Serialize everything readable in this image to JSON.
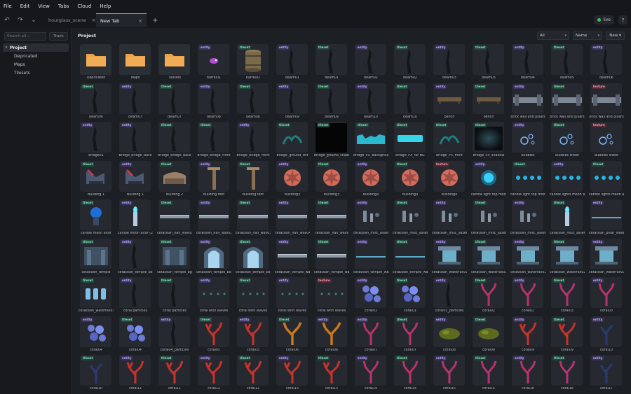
{
  "menu": [
    "File",
    "Edit",
    "View",
    "Tabs",
    "Cloud",
    "Help"
  ],
  "toolbar": {
    "undo_icon": "undo-icon",
    "redo_icon": "redo-icon",
    "dropdown_icon": "chevron-down-icon"
  },
  "tabs": [
    {
      "label": "hourglass_scene",
      "active": false
    },
    {
      "label": "New Tab",
      "active": true
    }
  ],
  "tab_close": "×",
  "tab_add": "+",
  "status": {
    "label": "live",
    "color": "#3fbf5b"
  },
  "help_label": "?",
  "sidebar": {
    "search_placeholder": "Search all...",
    "trash_label": "Trash",
    "tree": {
      "root": "Project",
      "children": [
        "Depricated",
        "Maps",
        "Tilesets"
      ]
    }
  },
  "main": {
    "title": "Project",
    "filter": "All",
    "sort": "Name",
    "new_label": "New ▾"
  },
  "assets": [
    {
      "name": "Depricated",
      "kind": "folder"
    },
    {
      "name": "Maps",
      "kind": "folder"
    },
    {
      "name": "Tilesets",
      "kind": "folder"
    },
    {
      "name": "barrel01",
      "badge": "entity",
      "art": "pink"
    },
    {
      "name": "barrel02",
      "badge": "tileset",
      "art": "barrel"
    },
    {
      "name": "beam01",
      "badge": "entity",
      "art": "dark"
    },
    {
      "name": "beam01",
      "badge": "tileset",
      "art": "dark"
    },
    {
      "name": "beam02",
      "badge": "entity",
      "art": "dark"
    },
    {
      "name": "beam02",
      "badge": "tileset",
      "art": "dark"
    },
    {
      "name": "beam03",
      "badge": "entity",
      "art": "dark"
    },
    {
      "name": "beam03",
      "badge": "tileset",
      "art": "dark"
    },
    {
      "name": "beam04",
      "badge": "entity",
      "art": "dark"
    },
    {
      "name": "beam05",
      "badge": "tileset",
      "art": "dark"
    },
    {
      "name": "beam06",
      "badge": "entity",
      "art": "dark"
    },
    {
      "name": "beam06",
      "badge": "tileset",
      "art": "dark"
    },
    {
      "name": "beam07",
      "badge": "entity",
      "art": "dark"
    },
    {
      "name": "beam07",
      "badge": "tileset",
      "art": "dark"
    },
    {
      "name": "beam08",
      "badge": "entity",
      "art": "dark"
    },
    {
      "name": "beam08",
      "badge": "tileset",
      "art": "dark"
    },
    {
      "name": "beam09",
      "badge": "entity",
      "art": "dark"
    },
    {
      "name": "beam09",
      "badge": "tileset",
      "art": "dark"
    },
    {
      "name": "beam10",
      "badge": "entity",
      "art": "dark"
    },
    {
      "name": "beam10",
      "badge": "tileset",
      "art": "dark"
    },
    {
      "name": "bench",
      "badge": "entity",
      "art": "bench"
    },
    {
      "name": "bench",
      "badge": "tileset",
      "art": "bench"
    },
    {
      "name": "brick wall and pillars",
      "badge": "entity",
      "art": "wall"
    },
    {
      "name": "brick wall and pillars",
      "badge": "tileset",
      "art": "wall"
    },
    {
      "name": "brick wall and pillars",
      "badge": "texture",
      "art": "wall"
    },
    {
      "name": "bridge01",
      "badge": "entity",
      "art": "dark"
    },
    {
      "name": "bridge_bridge_back",
      "badge": "entity",
      "art": "dark"
    },
    {
      "name": "bridge_bridge_back",
      "badge": "tileset",
      "art": "dark"
    },
    {
      "name": "bridge_bridge_front",
      "badge": "tileset",
      "art": "dark"
    },
    {
      "name": "bridge_bridge_front",
      "badge": "entity",
      "art": "dark"
    },
    {
      "name": "bridge_ground_left",
      "badge": "tileset",
      "art": "teal"
    },
    {
      "name": "bridge_ground_shadow",
      "badge": "tileset",
      "art": "black"
    },
    {
      "name": "bridge_PX_Background",
      "badge": "tileset",
      "art": "cyanwave"
    },
    {
      "name": "bridge_PX_for BG",
      "badge": "tileset",
      "art": "cyanbar"
    },
    {
      "name": "bridge_PX_front",
      "badge": "tileset",
      "art": "teal"
    },
    {
      "name": "bridge_PX_shadow",
      "badge": "tileset",
      "art": "glow"
    },
    {
      "name": "bubbles",
      "badge": "entity",
      "art": "bubbles"
    },
    {
      "name": "bubbles sheet",
      "badge": "tileset",
      "art": "bubbles"
    },
    {
      "name": "bubbles sheet",
      "badge": "texture",
      "art": "bubbles"
    },
    {
      "name": "Building 1",
      "badge": "tileset",
      "art": "ship"
    },
    {
      "name": "Building 1",
      "badge": "entity",
      "art": "ship"
    },
    {
      "name": "Building 2",
      "badge": "tileset",
      "art": "building"
    },
    {
      "name": "building foot",
      "badge": "entity",
      "art": "post"
    },
    {
      "name": "building foot",
      "badge": "tileset",
      "art": "post"
    },
    {
      "name": "building3",
      "badge": "entity",
      "art": "shell"
    },
    {
      "name": "building3",
      "badge": "tileset",
      "art": "shell"
    },
    {
      "name": "building4",
      "badge": "entity",
      "art": "shell"
    },
    {
      "name": "building4",
      "badge": "tileset",
      "art": "shell"
    },
    {
      "name": "building4",
      "badge": "texture",
      "art": "shell"
    },
    {
      "name": "candle light top moon...",
      "badge": "entity",
      "art": "orb"
    },
    {
      "name": "candle light top moon...",
      "badge": "tileset",
      "art": "dots"
    },
    {
      "name": "candle lights moon altar",
      "badge": "entity",
      "art": "dots"
    },
    {
      "name": "candle lights moon altar",
      "badge": "tileset",
      "art": "dots"
    },
    {
      "name": "candle moon altar",
      "badge": "tileset",
      "art": "altar"
    },
    {
      "name": "candle moon altar (2)",
      "badge": "entity",
      "art": "candle"
    },
    {
      "name": "cetacean_half_wall01",
      "badge": "tileset",
      "art": "ledge"
    },
    {
      "name": "cetacean_half_wall02",
      "badge": "entity",
      "art": "ledge"
    },
    {
      "name": "cetacean_half_wall03",
      "badge": "tileset",
      "art": "ledge"
    },
    {
      "name": "cetacean_half_wall04",
      "badge": "entity",
      "art": "ledge"
    },
    {
      "name": "cetacean_half_walls",
      "badge": "tileset",
      "art": "ledge"
    },
    {
      "name": "cetacean_misc_assets",
      "badge": "entity",
      "art": "misc"
    },
    {
      "name": "cetacean_misc_assets",
      "badge": "tileset",
      "art": "misc"
    },
    {
      "name": "cetacean_misc_assets2",
      "badge": "entity",
      "art": "misc"
    },
    {
      "name": "cetacean_misc_assets3",
      "badge": "tileset",
      "art": "misc"
    },
    {
      "name": "cetacean_misc_assets4",
      "badge": "entity",
      "art": "misc"
    },
    {
      "name": "cetacean_misc_assets",
      "badge": "tileset",
      "art": "candle"
    },
    {
      "name": "cetacean_pillar_water01",
      "badge": "entity",
      "art": "line"
    },
    {
      "name": "cetacean_temple",
      "badge": "tileset",
      "art": "temple"
    },
    {
      "name": "cetacean_temple_bac...",
      "badge": "entity",
      "art": "dark"
    },
    {
      "name": "cetacean_temple_bg",
      "badge": "tileset",
      "art": "temple"
    },
    {
      "name": "cetacean_temple_boss...",
      "badge": "entity",
      "art": "arch"
    },
    {
      "name": "cetacean_temple_boss...",
      "badge": "tileset",
      "art": "arch"
    },
    {
      "name": "cetacean_temple_water",
      "badge": "entity",
      "art": "ledge"
    },
    {
      "name": "cetacean_temple_wat...",
      "badge": "tileset",
      "art": "ledge"
    },
    {
      "name": "cetacean_temple_wat...",
      "badge": "entity",
      "art": "line"
    },
    {
      "name": "cetacean_temple_wat...",
      "badge": "tileset",
      "art": "line"
    },
    {
      "name": "cetacean_waterfall01",
      "badge": "entity",
      "art": "falls"
    },
    {
      "name": "cetacean_waterfall01",
      "badge": "tileset",
      "art": "falls"
    },
    {
      "name": "cetacean_waterfall02",
      "badge": "entity",
      "art": "falls"
    },
    {
      "name": "cetacean_waterfall02",
      "badge": "tileset",
      "art": "falls"
    },
    {
      "name": "cetacean_waterfall03",
      "badge": "entity",
      "art": "falls"
    },
    {
      "name": "cetacean_waterfall03",
      "badge": "tileset",
      "art": "jars"
    },
    {
      "name": "coral particles",
      "badge": "entity",
      "art": "dark"
    },
    {
      "name": "coral particles",
      "badge": "tileset",
      "art": "dark"
    },
    {
      "name": "coral with leaves",
      "badge": "entity",
      "art": "sprout"
    },
    {
      "name": "coral with leaves",
      "badge": "tileset",
      "art": "sprout"
    },
    {
      "name": "coral with leaves",
      "badge": "entity",
      "art": "sprout"
    },
    {
      "name": "coral with leaves",
      "badge": "texture",
      "art": "sprout"
    },
    {
      "name": "coral01",
      "badge": "entity",
      "art": "bluecoral"
    },
    {
      "name": "coral01",
      "badge": "tileset",
      "art": "bluecoral"
    },
    {
      "name": "coral01_particles",
      "badge": "entity",
      "art": "dark"
    },
    {
      "name": "coral02",
      "badge": "tileset",
      "art": "magenta"
    },
    {
      "name": "coral02",
      "badge": "entity",
      "art": "magenta"
    },
    {
      "name": "coral03",
      "badge": "tileset",
      "art": "magenta"
    },
    {
      "name": "coral03",
      "badge": "entity",
      "art": "magenta"
    },
    {
      "name": "coral04",
      "badge": "entity",
      "art": "bluecoral"
    },
    {
      "name": "coral04",
      "badge": "tileset",
      "art": "bluecoral"
    },
    {
      "name": "coral04_particles",
      "badge": "entity",
      "art": "dark"
    },
    {
      "name": "coral05",
      "badge": "tileset",
      "art": "redcoral"
    },
    {
      "name": "coral05",
      "badge": "entity",
      "art": "redcoral"
    },
    {
      "name": "coral06",
      "badge": "tileset",
      "art": "orange"
    },
    {
      "name": "coral06",
      "badge": "entity",
      "art": "orange"
    },
    {
      "name": "coral07",
      "badge": "entity",
      "art": "magenta"
    },
    {
      "name": "coral07",
      "badge": "tileset",
      "art": "magenta"
    },
    {
      "name": "coral08",
      "badge": "entity",
      "art": "olive"
    },
    {
      "name": "coral08",
      "badge": "tileset",
      "art": "olive"
    },
    {
      "name": "coral09",
      "badge": "entity",
      "art": "redcoral"
    },
    {
      "name": "coral09",
      "badge": "tileset",
      "art": "redcoral"
    },
    {
      "name": "coral10",
      "badge": "entity",
      "art": "navy"
    },
    {
      "name": "coral10",
      "badge": "tileset",
      "art": "navy"
    },
    {
      "name": "coral11",
      "badge": "entity",
      "art": "redcoral"
    },
    {
      "name": "coral11",
      "badge": "tileset",
      "art": "redcoral"
    },
    {
      "name": "coral12",
      "badge": "entity",
      "art": "redcoral"
    },
    {
      "name": "coral12",
      "badge": "tileset",
      "art": "redcoral"
    },
    {
      "name": "coral13",
      "badge": "entity",
      "art": "redcoral"
    },
    {
      "name": "coral13",
      "badge": "tileset",
      "art": "redcoral"
    },
    {
      "name": "coral14",
      "badge": "entity",
      "art": "magenta"
    },
    {
      "name": "coral14",
      "badge": "tileset",
      "art": "magenta"
    },
    {
      "name": "coral15",
      "badge": "entity",
      "art": "magenta"
    },
    {
      "name": "coral15",
      "badge": "tileset",
      "art": "magenta"
    },
    {
      "name": "coral16",
      "badge": "entity",
      "art": "magenta"
    },
    {
      "name": "coral16",
      "badge": "tileset",
      "art": "magenta"
    },
    {
      "name": "coral17",
      "badge": "entity",
      "art": "navy"
    }
  ],
  "colors": {
    "accent": "#c9a227",
    "folder": "#e8a24a",
    "badge_entity": "#b9a6ff",
    "badge_tileset": "#7fe0b8",
    "badge_texture": "#ff9bb0"
  }
}
